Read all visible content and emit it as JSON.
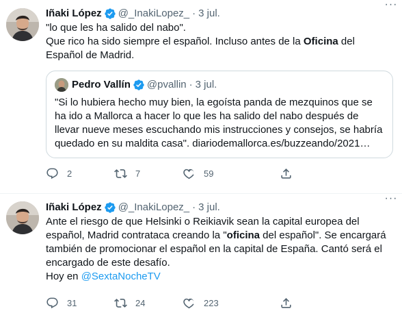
{
  "tweets": [
    {
      "author": "Iñaki López",
      "handle": "@_InakiLopez_",
      "time": "3 jul.",
      "lines": [
        "\"lo que les ha salido del nabo\"."
      ],
      "body_pre": "Que rico ha sido siempre el español. Incluso antes de la ",
      "body_bold": "Oficina",
      "body_post": " del Español de Madrid.",
      "quote": {
        "author": "Pedro Vallín",
        "handle": "@pvallin",
        "time": "3 jul.",
        "text": "\"Si lo hubiera hecho muy bien, la egoísta panda de mezquinos que se ha ido a Mallorca a hacer lo que les ha salido del nabo después de llevar nueve meses escuchando mis instrucciones y consejos, se habría quedado en su maldita casa\". diariodemallorca.es/buzzeando/2021…"
      },
      "stats": {
        "replies": "2",
        "retweets": "7",
        "likes": "59"
      }
    },
    {
      "author": "Iñaki López",
      "handle": "@_InakiLopez_",
      "time": "3 jul.",
      "body_pre": "Ante el riesgo de que Helsinki o Reikiavik sean la capital europea del español, Madrid contrataca creando la \"",
      "body_bold": "oficina",
      "body_post": " del español\". Se encargará también de promocionar el español en la capital de España. Cantó será el encargado de este desafío.",
      "footer_pre": "Hoy en ",
      "footer_mention": "@SextaNocheTV",
      "stats": {
        "replies": "31",
        "retweets": "24",
        "likes": "223"
      }
    }
  ],
  "colors": {
    "accent": "#1d9bf0",
    "muted": "#536471",
    "text": "#0f1419",
    "border": "#cfd9de"
  },
  "icons": {
    "verified": "verified-badge-icon",
    "reply": "reply-icon",
    "retweet": "retweet-icon",
    "like": "heart-icon",
    "share": "share-icon",
    "more": "more-icon"
  }
}
